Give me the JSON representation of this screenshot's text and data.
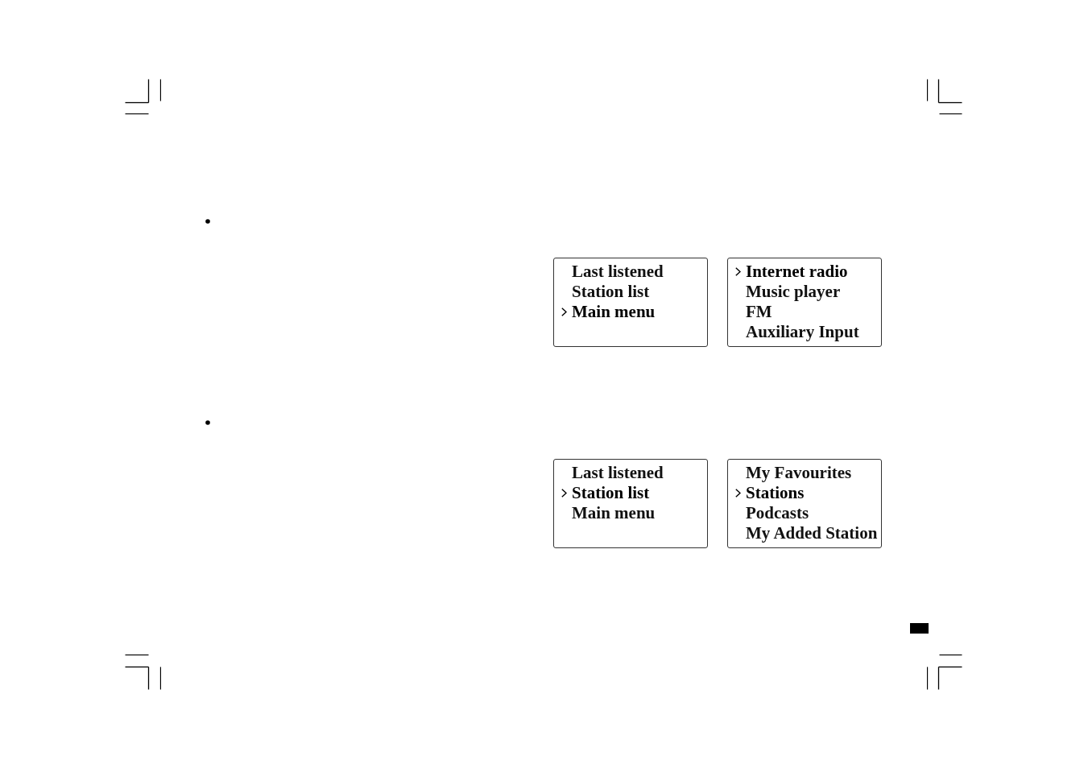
{
  "sections": [
    {
      "screens": [
        {
          "items": [
            {
              "label": "Last listened",
              "selected": false
            },
            {
              "label": "Station list",
              "selected": false
            },
            {
              "label": "Main menu",
              "selected": true
            }
          ]
        },
        {
          "items": [
            {
              "label": "Internet radio",
              "selected": true
            },
            {
              "label": "Music player",
              "selected": false
            },
            {
              "label": "FM",
              "selected": false
            },
            {
              "label": "Auxiliary Input",
              "selected": false
            }
          ]
        }
      ]
    },
    {
      "screens": [
        {
          "items": [
            {
              "label": "Last listened",
              "selected": false
            },
            {
              "label": "Station list",
              "selected": true
            },
            {
              "label": "Main menu",
              "selected": false
            }
          ]
        },
        {
          "items": [
            {
              "label": "My Favourites",
              "selected": false
            },
            {
              "label": "Stations",
              "selected": true
            },
            {
              "label": "Podcasts",
              "selected": false
            },
            {
              "label": "My Added Station",
              "selected": false
            }
          ]
        }
      ]
    }
  ]
}
